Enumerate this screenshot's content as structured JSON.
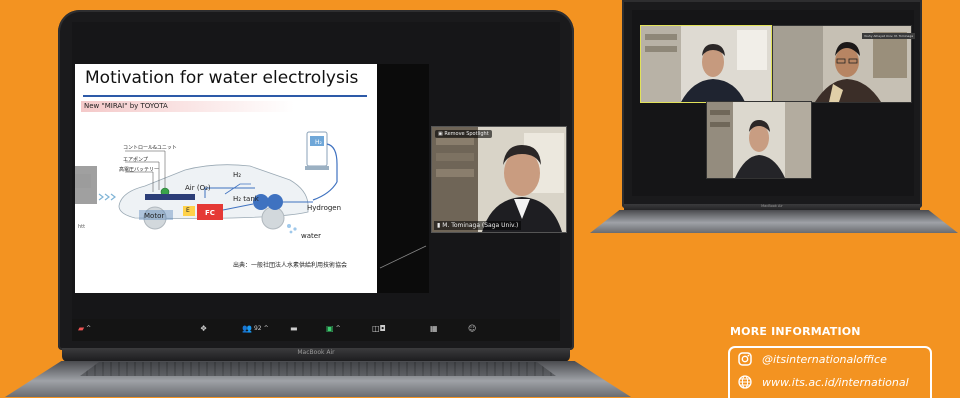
{
  "big_laptop": {
    "model_label": "MacBook Air",
    "slide": {
      "title": "Motivation for water electrolysis",
      "subtitle": "New \"MIRAI\" by TOYOTA",
      "labels_jp": [
        "コントロール&ユニット",
        "エアポンプ",
        "高電圧バッテリー"
      ],
      "label_air": "Air (O₂)",
      "label_h2": "H₂",
      "label_tank": "H₂ tank",
      "label_motor": "Motor",
      "label_e": "E",
      "label_fc": "FC",
      "label_hydrogen": "Hydrogen",
      "label_water": "water",
      "label_hydro_icon": "H₂",
      "source": "出典：一般社団法人水素供給利用技術協会",
      "edge_text": "htt"
    },
    "video": {
      "spotlight_label": "Remove Spotlight",
      "participant_name": "M. Tominaga (Saga Univ.)"
    },
    "toolbar": {
      "participants_count": "92",
      "caret": "^"
    }
  },
  "small_laptop": {
    "model_label": "MacBook Air",
    "tile_name": "Yoshy Alhayat Univ. M. Tominaga"
  },
  "info": {
    "title": "MORE INFORMATION",
    "instagram": "@itsinternationaloffice",
    "website": "www.its.ac.id/international"
  },
  "colors": {
    "background": "#F39321",
    "slide_rule": "#2d5aa8",
    "fc_red": "#e53935",
    "active_tile_border": "#e2e25a"
  }
}
